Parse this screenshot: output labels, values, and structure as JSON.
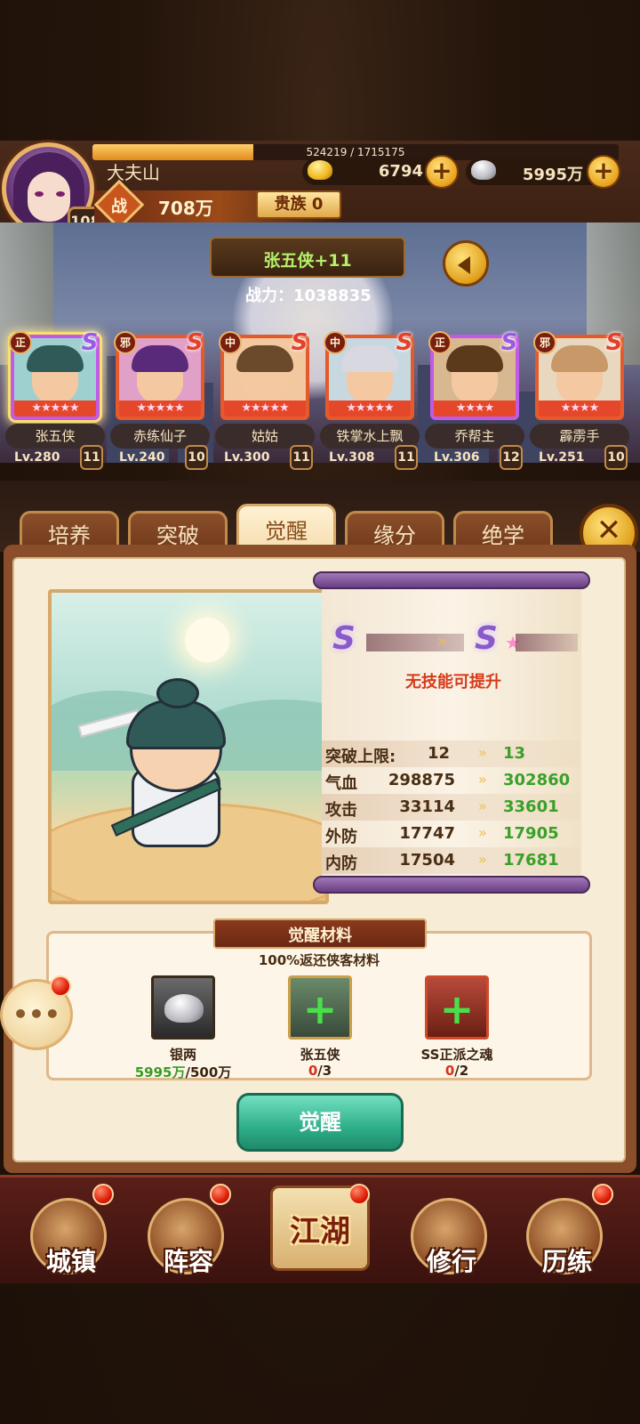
{
  "player": {
    "name": "大夫山",
    "level": "108",
    "exp_text": "524219 / 1715175",
    "exp_fraction": 0.306,
    "power_prefix": "战",
    "power": "708万",
    "noble_label": "贵族 0"
  },
  "currencies": {
    "gold": "6794",
    "silver": "5995万",
    "plus": "+"
  },
  "hero_header": {
    "name": "张五侠+11",
    "combat_power": "战力：1038835"
  },
  "heroes": [
    {
      "name": "张五侠",
      "faction": "正",
      "grade": "S",
      "level": "Lv.280",
      "rank": "11",
      "stars": "★★★★★",
      "selected": true
    },
    {
      "name": "赤练仙子",
      "faction": "邪",
      "grade": "S",
      "level": "Lv.240",
      "rank": "10",
      "stars": "★★★★★"
    },
    {
      "name": "姑姑",
      "faction": "中",
      "grade": "S",
      "level": "Lv.300",
      "rank": "11",
      "stars": "★★★★★"
    },
    {
      "name": "铁掌水上飘",
      "faction": "中",
      "grade": "S",
      "level": "Lv.308",
      "rank": "11",
      "stars": "★★★★★"
    },
    {
      "name": "乔帮主",
      "faction": "正",
      "grade": "S",
      "level": "Lv.306",
      "rank": "12",
      "stars": "★★★★"
    },
    {
      "name": "霹雳手",
      "faction": "邪",
      "grade": "S",
      "level": "Lv.251",
      "rank": "10",
      "stars": "★★★★"
    }
  ],
  "tabs": [
    "培养",
    "突破",
    "觉醒",
    "缘分",
    "绝学"
  ],
  "active_tab": "觉醒",
  "awaken": {
    "skill_note": "无技能可提升",
    "stats": [
      {
        "label": "突破上限:",
        "current": "12",
        "next": "13"
      },
      {
        "label": "气血",
        "current": "298875",
        "next": "302860"
      },
      {
        "label": "攻击",
        "current": "33114",
        "next": "33601"
      },
      {
        "label": "外防",
        "current": "17747",
        "next": "17905"
      },
      {
        "label": "内防",
        "current": "17504",
        "next": "17681"
      }
    ],
    "materials_title": "觉醒材料",
    "materials_subtitle": "100%返还侠客材料",
    "materials": [
      {
        "name": "银两",
        "have": "5995万",
        "need": "/500万"
      },
      {
        "name": "张五侠",
        "have": "0",
        "need": "/3"
      },
      {
        "name": "SS正派之魂",
        "have": "0",
        "need": "/2"
      }
    ],
    "button_label": "觉醒"
  },
  "bottom_nav": [
    "城镇",
    "阵容",
    "江湖",
    "修行",
    "历练"
  ],
  "colors": {
    "accent_gold": "#e8a21c",
    "stat_up_green": "#3aa028",
    "warning_red": "#d63a1a",
    "button_teal": "#2fae8a"
  }
}
